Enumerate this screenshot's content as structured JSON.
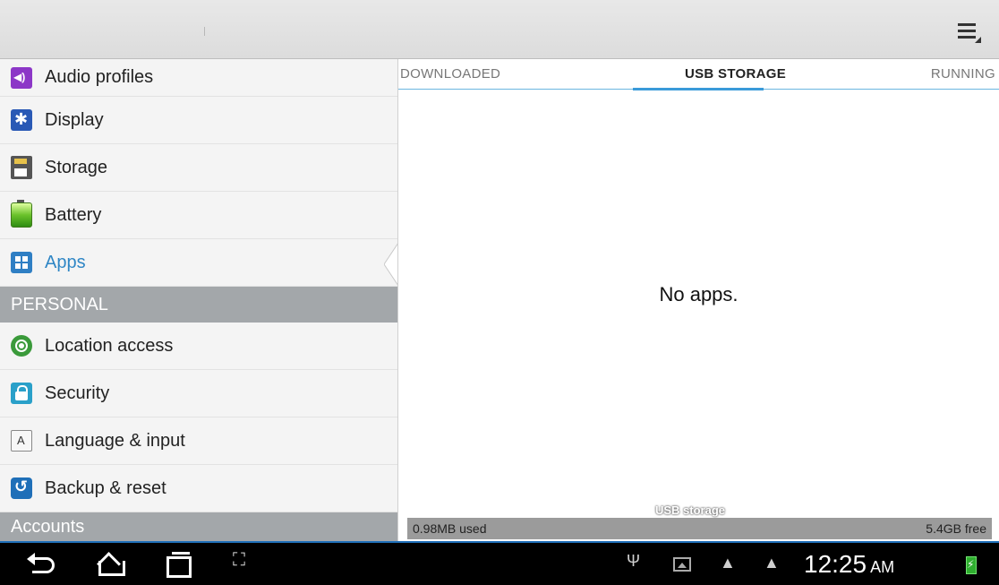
{
  "settings_list": {
    "items_top": [
      {
        "label": "Audio profiles",
        "icon": "audio-profiles-icon"
      },
      {
        "label": "Display",
        "icon": "display-icon"
      },
      {
        "label": "Storage",
        "icon": "storage-icon"
      },
      {
        "label": "Battery",
        "icon": "battery-icon"
      },
      {
        "label": "Apps",
        "icon": "apps-icon",
        "active": true
      }
    ],
    "section_personal": "PERSONAL",
    "items_personal": [
      {
        "label": "Location access",
        "icon": "location-icon"
      },
      {
        "label": "Security",
        "icon": "lock-icon"
      },
      {
        "label": "Language & input",
        "icon": "language-icon"
      },
      {
        "label": "Backup & reset",
        "icon": "backup-icon"
      }
    ],
    "section_accounts": "Accounts"
  },
  "tabs": [
    {
      "label": "DOWNLOADED",
      "selected": false
    },
    {
      "label": "USB STORAGE",
      "selected": true
    },
    {
      "label": "RUNNING",
      "selected": false
    }
  ],
  "content": {
    "empty_message": "No apps."
  },
  "storage": {
    "title": "USB storage",
    "used": "0.98MB used",
    "free": "5.4GB free"
  },
  "status_bar": {
    "time": "12:25",
    "ampm": "AM"
  },
  "colors": {
    "accent": "#3a9ad9",
    "section_header": "#a3a7aa",
    "active_item": "#2f86c5"
  }
}
